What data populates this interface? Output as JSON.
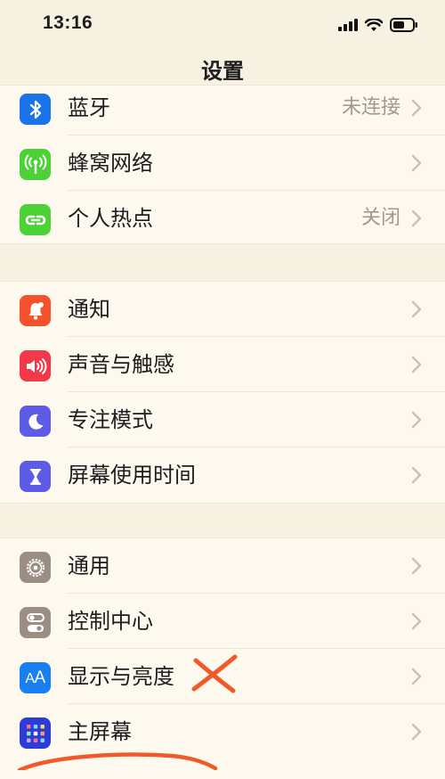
{
  "status_bar": {
    "time": "13:16"
  },
  "nav": {
    "title": "设置"
  },
  "sections": [
    {
      "items": [
        {
          "label": "蓝牙",
          "value": "未连接",
          "icon": "bluetooth-icon",
          "icon_color": "#1a73e8"
        },
        {
          "label": "蜂窝网络",
          "value": "",
          "icon": "antenna-icon",
          "icon_color": "#4cd137"
        },
        {
          "label": "个人热点",
          "value": "关闭",
          "icon": "hotspot-link-icon",
          "icon_color": "#4cd137"
        }
      ]
    },
    {
      "items": [
        {
          "label": "通知",
          "value": "",
          "icon": "bell-icon",
          "icon_color": "#f5512d"
        },
        {
          "label": "声音与触感",
          "value": "",
          "icon": "speaker-icon",
          "icon_color": "#f2394a"
        },
        {
          "label": "专注模式",
          "value": "",
          "icon": "moon-icon",
          "icon_color": "#5e5ce6"
        },
        {
          "label": "屏幕使用时间",
          "value": "",
          "icon": "hourglass-icon",
          "icon_color": "#5e5ce6"
        }
      ]
    },
    {
      "items": [
        {
          "label": "通用",
          "value": "",
          "icon": "gear-icon",
          "icon_color": "#9a8f82"
        },
        {
          "label": "控制中心",
          "value": "",
          "icon": "toggles-icon",
          "icon_color": "#9a8f82"
        },
        {
          "label": "显示与亮度",
          "value": "",
          "icon": "text-size-icon",
          "icon_color": "#1a7ff0"
        },
        {
          "label": "主屏幕",
          "value": "",
          "icon": "home-grid-icon",
          "icon_color": "#2d3bd9"
        }
      ]
    }
  ],
  "annotations": {
    "cross_color": "#f05a28",
    "circle_color": "#f05a28"
  }
}
